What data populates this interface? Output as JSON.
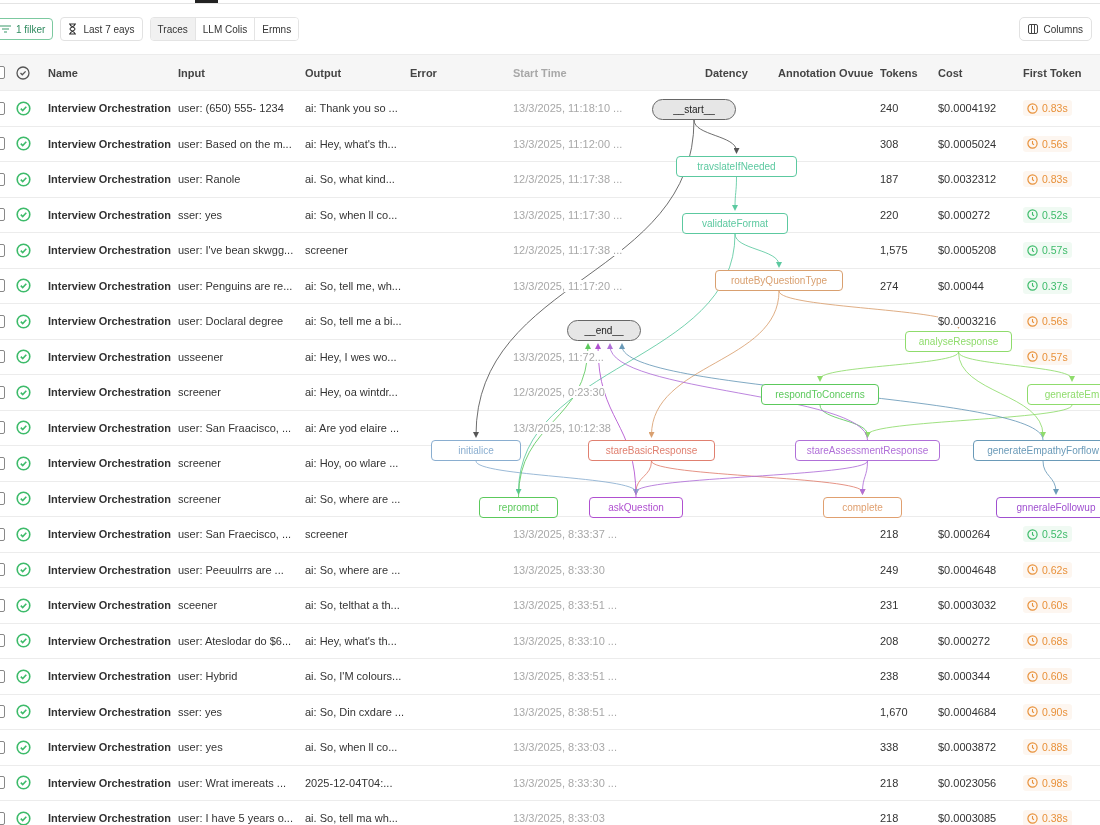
{
  "toolbar": {
    "filter_button": "1 filker",
    "date_button": "Last 7 eays",
    "view_tabs": [
      {
        "label": "Traces",
        "selected": true
      },
      {
        "label": "LLM Colis",
        "selected": false
      },
      {
        "label": "Ermns",
        "selected": false
      }
    ],
    "columns_button": "Columns"
  },
  "table": {
    "header_checked": false,
    "columns": [
      "Name",
      "Input",
      "Output",
      "Error",
      "Start Time",
      "Datency",
      "Annotation Ovuue",
      "Tokens",
      "Cost",
      "First Token"
    ],
    "rows": [
      {
        "checked": false,
        "name": "Interview Orchestration",
        "input": "user: (650) 555- 1234",
        "output": "ai: Thank you so ...",
        "start_time": "13/3/2025, 11:18:10 ...",
        "tokens": "240",
        "cost": "$0.0004192",
        "first_token": {
          "text": "0.83s",
          "color": "#e8913a"
        }
      },
      {
        "checked": false,
        "name": "Interview Orchestration",
        "input": "user: Based on the m...",
        "output": "ai: Hey, what's th...",
        "start_time": "13/3/2025, 11:12:00 ...",
        "tokens": "308",
        "cost": "$0.0005024",
        "first_token": {
          "text": "0.56s",
          "color": "#e8913a"
        }
      },
      {
        "checked": false,
        "name": "Interview Orchestration",
        "input": "user: Ranole",
        "output": "ai. So, what kind...",
        "start_time": "12/3/2025, 11:17:38 ...",
        "tokens": "187",
        "cost": "$0.0032312",
        "first_token": {
          "text": "0.83s",
          "color": "#e8913a"
        }
      },
      {
        "checked": false,
        "name": "Interview Orchestration",
        "input": "sser: yes",
        "output": "ai: So, when ll co...",
        "start_time": "13/3/2025, 11:17:30 ...",
        "tokens": "220",
        "cost": "$0.000272",
        "first_token": {
          "text": "0.52s",
          "color": "#3dbb6a"
        }
      },
      {
        "checked": false,
        "name": "Interview Orchestration",
        "input": "user: I've bean skwgg...",
        "output": "screener",
        "start_time": "12/3/2025, 11:17:38 ...",
        "tokens": "1,575",
        "cost": "$0.0005208",
        "first_token": {
          "text": "0.57s",
          "color": "#3dbb6a"
        }
      },
      {
        "checked": false,
        "name": "Interview Orchestration",
        "input": "user: Penguins are re...",
        "output": "ai: So, tell me, wh...",
        "start_time": "13/3/2025, 11:17:20 ...",
        "tokens": "274",
        "cost": "$0.00044",
        "first_token": {
          "text": "0.37s",
          "color": "#3dbb6a"
        }
      },
      {
        "checked": false,
        "name": "Interview Orchestration",
        "input": "user: Doclaral degree",
        "output": "ai: So, tell me a bi...",
        "cost": "$0.0003216",
        "first_token": {
          "text": "0.56s",
          "color": "#e8913a"
        }
      },
      {
        "checked": false,
        "name": "Interview Orchestration",
        "input": "usseener",
        "output": "ai: Hey, I wes wo...",
        "start_time": "13/3/2025, 11:72...",
        "first_token": {
          "text": "0.57s",
          "color": "#e8913a"
        }
      },
      {
        "checked": false,
        "name": "Interview Orchestration",
        "input": "screener",
        "output": "ai: Hey, oa wintdr...",
        "start_time": "12/3/2025, 0:23:30"
      },
      {
        "checked": false,
        "name": "Interview Orchestration",
        "input": "user: San Fraacisco, ...",
        "output": "ai: Are yod elaire ...",
        "start_time": "13/3/2025, 10:12:38"
      },
      {
        "checked": false,
        "name": "Interview Orchestration",
        "input": "screener",
        "output": "ai: Hoy, oo wlare ..."
      },
      {
        "checked": false,
        "name": "Interview Orchestration",
        "input": "screener",
        "output": "ai: So, where are ..."
      },
      {
        "checked": false,
        "name": "Interview Orchestration",
        "input": "user: San Fraecisco, ...",
        "output": "screener",
        "start_time": "13/3/2025, 8:33:37 ...",
        "tokens": "218",
        "cost": "$0.000264",
        "first_token": {
          "text": "0.52s",
          "color": "#3dbb6a"
        }
      },
      {
        "checked": false,
        "name": "Interview Orchestration",
        "input": "user: Peeuulrrs are ...",
        "output": "ai: So, where are ...",
        "start_time": "13/3/2025, 8:33:30",
        "tokens": "249",
        "cost": "$0.0004648",
        "first_token": {
          "text": "0.62s",
          "color": "#e8913a"
        }
      },
      {
        "checked": false,
        "name": "Interview Orchestration",
        "input": "sceener",
        "output": "ai: So, telthat a th...",
        "start_time": "13/3/2025, 8:33:51 ...",
        "tokens": "231",
        "cost": "$0.0003032",
        "first_token": {
          "text": "0.60s",
          "color": "#e8913a"
        }
      },
      {
        "checked": false,
        "name": "Interview Orchestration",
        "input": "user: Ateslodar do $6...",
        "output": "ai: Hey, what's th...",
        "start_time": "13/3/2025, 8:33:10 ...",
        "tokens": "208",
        "cost": "$0.000272",
        "first_token": {
          "text": "0.68s",
          "color": "#e8913a"
        }
      },
      {
        "checked": false,
        "name": "Interview Orchestration",
        "input": "user: Hybrid",
        "output": "ai. So, I'M colours...",
        "start_time": "13/3/2025, 8:33:51 ...",
        "tokens": "238",
        "cost": "$0.000344",
        "first_token": {
          "text": "0.60s",
          "color": "#e8913a"
        }
      },
      {
        "checked": false,
        "name": "Interview Orchestration",
        "input": "sser: yes",
        "output": "ai: So, Din cxdare ...",
        "start_time": "13/3/2025, 8:38:51 ...",
        "tokens": "1,670",
        "cost": "$0.0004684",
        "first_token": {
          "text": "0.90s",
          "color": "#e8913a"
        }
      },
      {
        "checked": false,
        "name": "Interview Orchestration",
        "input": "user: yes",
        "output": "ai. So, when ll co...",
        "start_time": "13/3/2025, 8:33:03 ...",
        "tokens": "338",
        "cost": "$0.0003872",
        "first_token": {
          "text": "0.88s",
          "color": "#e8913a"
        }
      },
      {
        "checked": false,
        "name": "Interview Orchestration",
        "input": "user: Wrat imereats ...",
        "output": "2025-12-04T04:...",
        "start_time": "13/3/2025, 8:33:30 ...",
        "tokens": "218",
        "cost": "$0.0023056",
        "first_token": {
          "text": "0.98s",
          "color": "#e8913a"
        }
      },
      {
        "checked": false,
        "name": "Interview Orchestration",
        "input": "user: I have 5 years o...",
        "output": "ai. So, tell ma wh...",
        "start_time": "13/3/2025, 8:33:03",
        "tokens": "218",
        "cost": "$0.0003085",
        "first_token": {
          "text": "0.38s",
          "color": "#e8913a"
        }
      }
    ]
  },
  "graph": {
    "nodes": [
      {
        "label": "__start__",
        "kind": "terminal"
      },
      {
        "label": "travslateIfNeeded",
        "kind": "step",
        "color": "#5cc9a0"
      },
      {
        "label": "validateFormat",
        "kind": "step",
        "color": "#5cc9a0"
      },
      {
        "label": "routeByQuestionType",
        "kind": "step",
        "color": "#d9a070"
      },
      {
        "label": "__end__",
        "kind": "terminal"
      },
      {
        "label": "analyseResponse",
        "kind": "step",
        "color": "#8fdc6c"
      },
      {
        "label": "respondToConcerns",
        "kind": "step",
        "color": "#5cc95c"
      },
      {
        "label": "generateEm",
        "kind": "step",
        "color": "#8fdc6c"
      },
      {
        "label": "initialice",
        "kind": "step",
        "color": "#8aaed0"
      },
      {
        "label": "stareBasicResponse",
        "kind": "step",
        "color": "#e08070"
      },
      {
        "label": "stareAssessmentResponse",
        "kind": "step",
        "color": "#b070d8"
      },
      {
        "label": "generateEmpathyForflow",
        "kind": "step",
        "color": "#6a9ab8"
      },
      {
        "label": "reprompt",
        "kind": "step",
        "color": "#5cc95c"
      },
      {
        "label": "askQuestion",
        "kind": "step",
        "color": "#b050d0"
      },
      {
        "label": "complete",
        "kind": "step",
        "color": "#e0a070"
      },
      {
        "label": "gnneraleFollowup",
        "kind": "step",
        "color": "#a050d0"
      }
    ]
  }
}
